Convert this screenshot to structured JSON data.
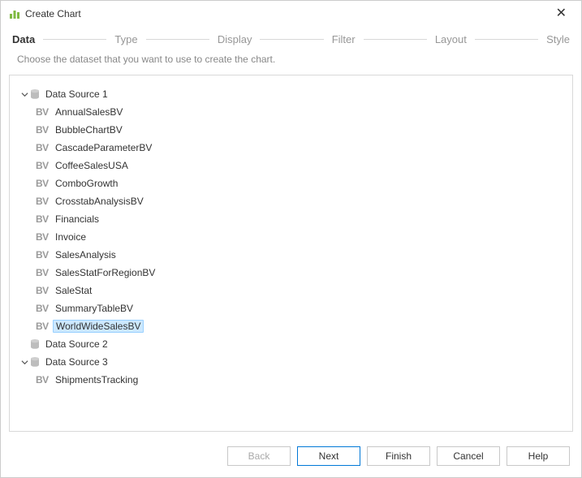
{
  "window": {
    "title": "Create Chart"
  },
  "steps": {
    "data": "Data",
    "type": "Type",
    "display": "Display",
    "filter": "Filter",
    "layout": "Layout",
    "style": "Style"
  },
  "subtitle": "Choose the dataset that you want to use to create the chart.",
  "tree": {
    "bvPrefix": "BV",
    "ds1": {
      "label": "Data Source 1",
      "items": [
        "AnnualSalesBV",
        "BubbleChartBV",
        "CascadeParameterBV",
        "CoffeeSalesUSA",
        "ComboGrowth",
        "CrosstabAnalysisBV",
        "Financials",
        "Invoice",
        "SalesAnalysis",
        "SalesStatForRegionBV",
        "SaleStat",
        "SummaryTableBV",
        "WorldWideSalesBV"
      ],
      "selectedIndex": 12
    },
    "ds2": {
      "label": "Data Source 2"
    },
    "ds3": {
      "label": "Data Source 3",
      "items": [
        "ShipmentsTracking"
      ]
    }
  },
  "buttons": {
    "back": "Back",
    "next": "Next",
    "finish": "Finish",
    "cancel": "Cancel",
    "help": "Help"
  }
}
